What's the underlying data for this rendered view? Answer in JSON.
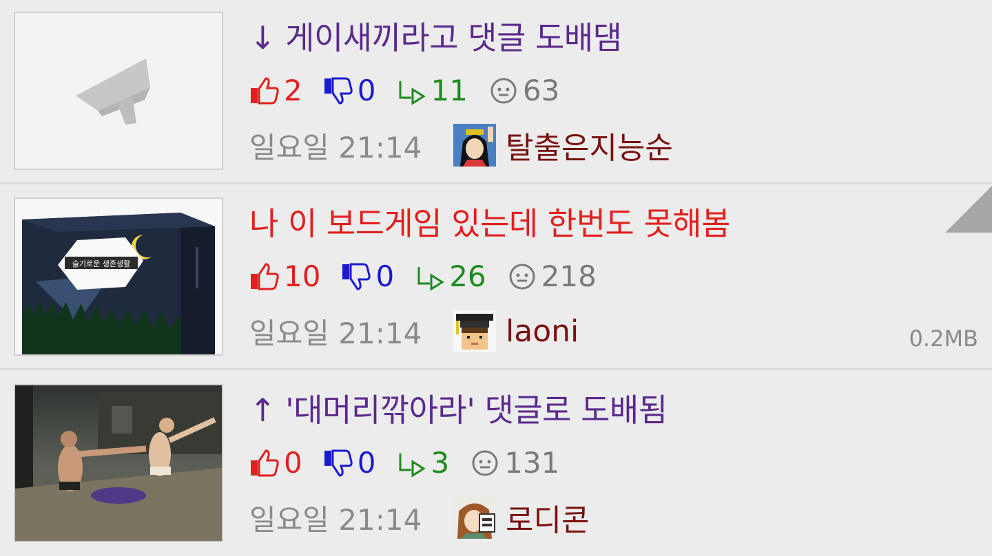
{
  "posts": [
    {
      "title": "↓ 게이새끼라고 댓글 도배댐",
      "title_color": "#5a2a8c",
      "likes": "2",
      "dislikes": "0",
      "shares": "11",
      "views": "63",
      "time": "일요일 21:14",
      "author": "탈출은지능순",
      "thumbnail": "graduation-cap-placeholder",
      "file_size": ""
    },
    {
      "title": "나 이 보드게임 있는데 한번도 못해봄",
      "title_color": "#e0201e",
      "likes": "10",
      "dislikes": "0",
      "shares": "26",
      "views": "218",
      "time": "일요일 21:14",
      "author": "laoni",
      "thumbnail": "board-game-box-image",
      "thumb_text": "슬기로운 생존생활",
      "file_size": "0.2MB"
    },
    {
      "title": "↑ '대머리깎아라' 댓글로 도배됨",
      "title_color": "#5a2a8c",
      "likes": "0",
      "dislikes": "0",
      "shares": "3",
      "views": "131",
      "time": "일요일 21:14",
      "author": "로디콘",
      "thumbnail": "game-scene-image",
      "file_size": ""
    }
  ],
  "colors": {
    "like": "#e0201e",
    "dislike": "#1a1ad0",
    "share": "#1c8a1c",
    "view": "#7a7a7a"
  }
}
